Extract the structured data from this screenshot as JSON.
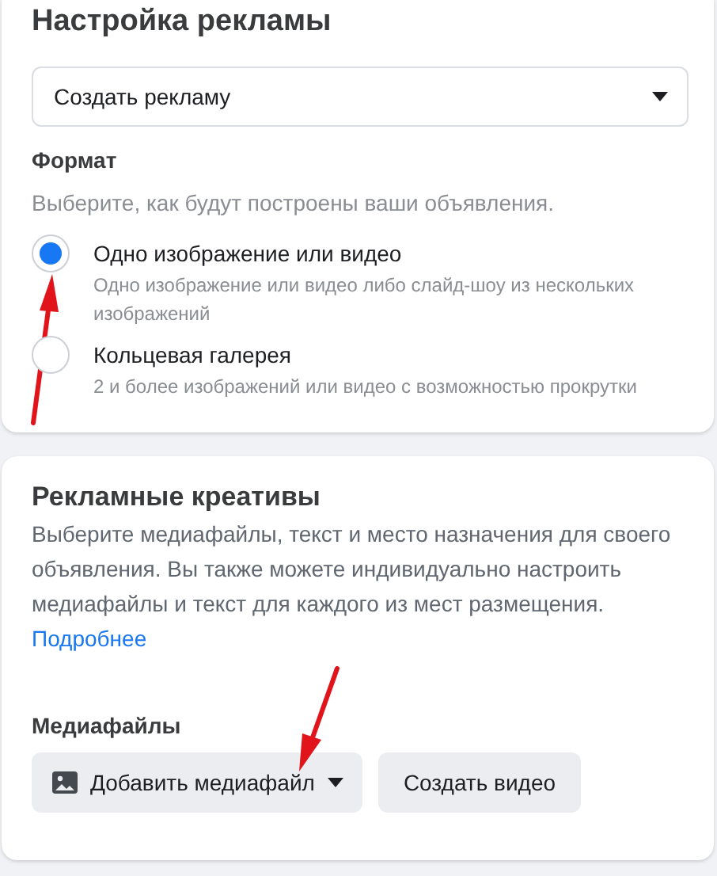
{
  "ad_setup": {
    "title": "Настройка рекламы",
    "dropdown": {
      "value": "Создать рекламу"
    },
    "format": {
      "label": "Формат",
      "hint": "Выберите, как будут построены ваши объявления.",
      "options": [
        {
          "label": "Одно изображение или видео",
          "description": "Одно изображение или видео либо слайд-шоу из нескольких изображений",
          "selected": true
        },
        {
          "label": "Кольцевая галерея",
          "description": "2 и более изображений или видео с возможностью прокрутки",
          "selected": false
        }
      ]
    }
  },
  "creatives": {
    "title": "Рекламные креативы",
    "description": "Выберите медиафайлы, текст и место назначения для своего объявления. Вы также можете индивидуально настроить медиафайлы и текст для каждого из мест размещения.",
    "link": "Подробнее",
    "media_label": "Медиафайлы",
    "buttons": [
      {
        "kind": "menu",
        "label": "Добавить медиафайл"
      },
      {
        "kind": "plain",
        "label": "Создать видео"
      }
    ]
  }
}
